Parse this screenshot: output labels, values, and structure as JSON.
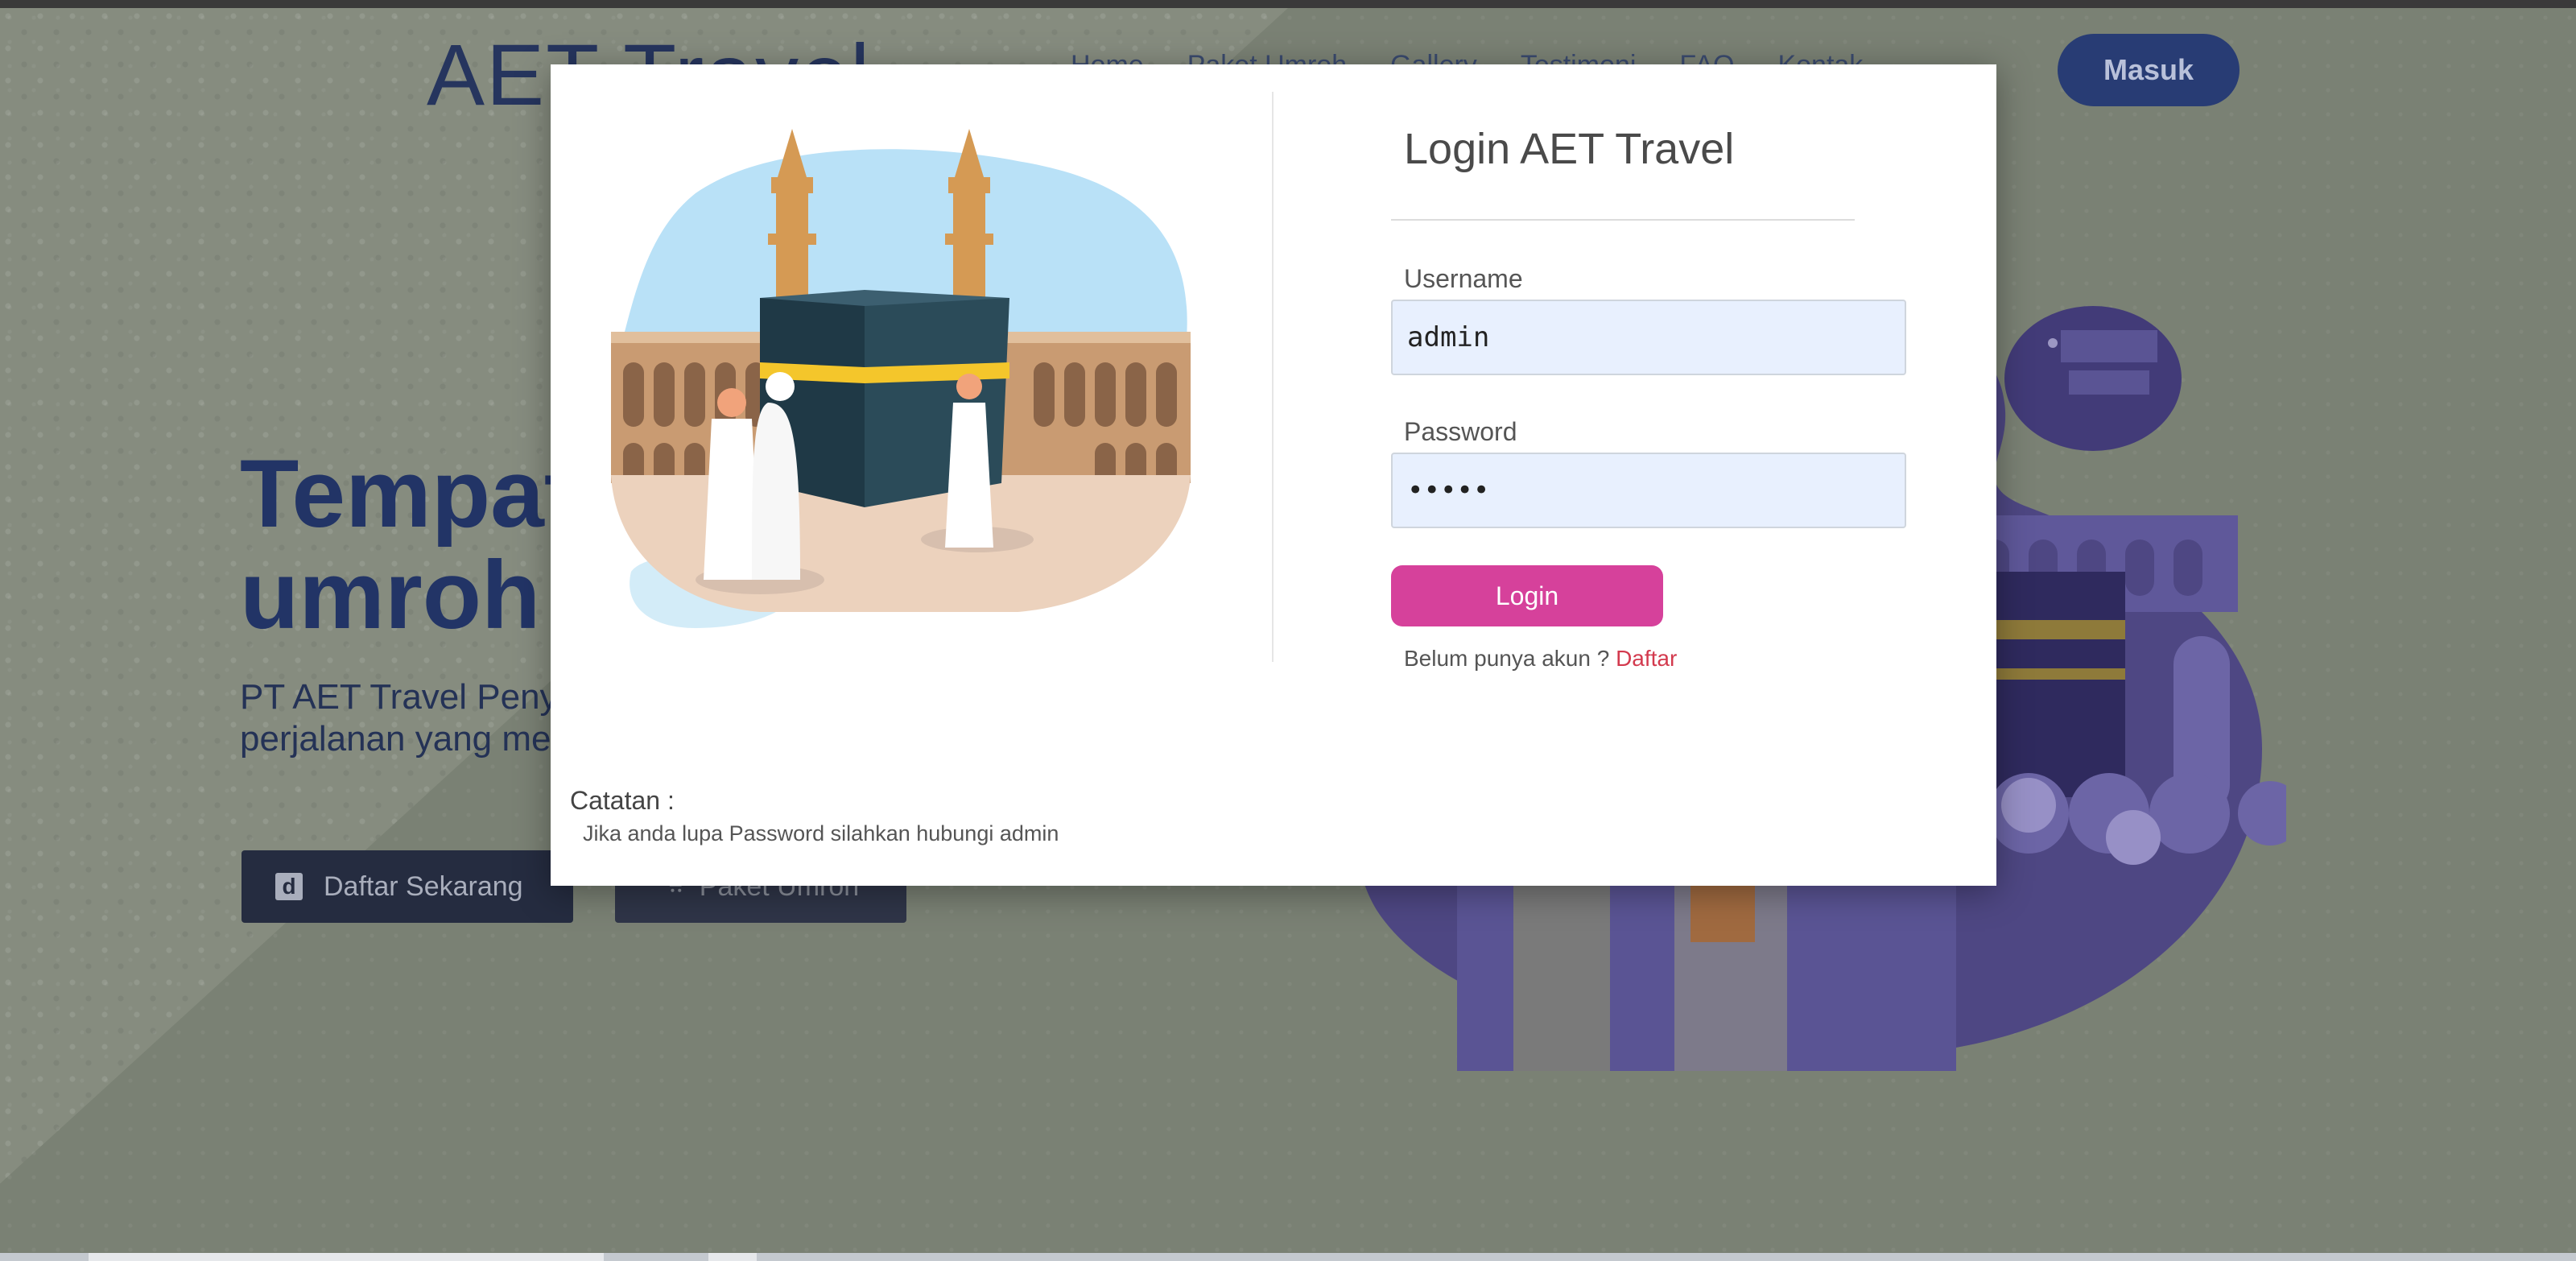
{
  "background": {
    "brand": "AET Travel",
    "nav": [
      "Home",
      "Paket Umroh",
      "Gallery",
      "Testimoni",
      "FAQ",
      "Kontak"
    ],
    "login_button": "Masuk",
    "hero_title_line1": "Tempat terbaik",
    "hero_title_line2": "umroh bersama",
    "hero_sub_line1": "PT AET Travel Penyelenggara umroh dengan",
    "hero_sub_line2": "perjalanan yang menyenangkan",
    "register_button": "Daftar Sekarang",
    "packages_button": "Paket Umroh"
  },
  "modal": {
    "title": "Login AET Travel",
    "username_label": "Username",
    "username_value": "admin",
    "password_label": "Password",
    "password_value": "•••••",
    "submit_label": "Login",
    "no_account_text": "Belum punya akun ?",
    "register_link": "Daftar",
    "note_title": "Catatan :",
    "note_body": "Jika anda lupa Password silahkan hubungi admin"
  },
  "colors": {
    "overlay_bg": "#7c8474",
    "brand_navy": "#26355e",
    "login_pink": "#d6419b",
    "link_red": "#d33a4e",
    "input_fill": "#e8f0fe"
  }
}
